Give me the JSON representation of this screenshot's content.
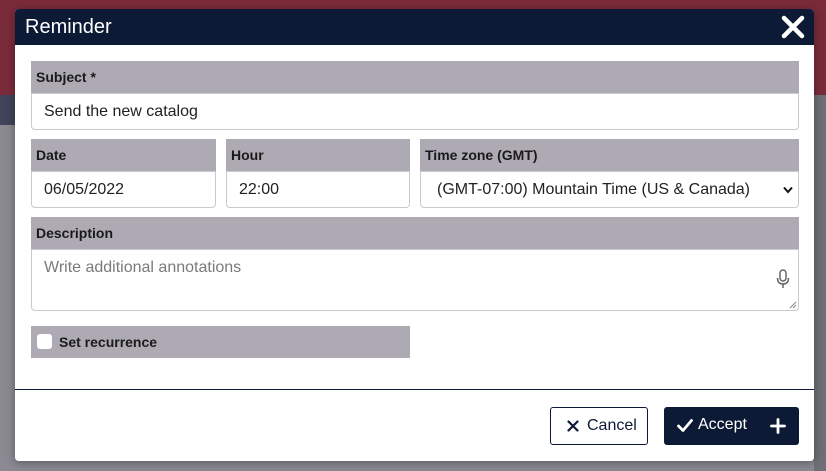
{
  "modal": {
    "title": "Reminder",
    "close_icon": "close-icon"
  },
  "form": {
    "subject": {
      "label": "Subject *",
      "value": "Send the new catalog"
    },
    "date": {
      "label": "Date",
      "value": "06/05/2022"
    },
    "hour": {
      "label": "Hour",
      "value": "22:00"
    },
    "timezone": {
      "label": "Time zone (GMT)",
      "selected": "(GMT-07:00) Mountain Time (US & Canada)"
    },
    "description": {
      "label": "Description",
      "placeholder": "Write additional annotations",
      "mic_icon": "microphone-icon"
    },
    "recurrence": {
      "label": "Set recurrence",
      "checked": false
    }
  },
  "footer": {
    "cancel_label": "Cancel",
    "cancel_icon": "times-icon",
    "accept_label": "Accept",
    "accept_icon": "check-icon",
    "accept_extra_icon": "plus-icon"
  },
  "colors": {
    "header_bg": "#0c1a35",
    "label_bg": "#aeaab4",
    "accent": "#0c1a35"
  }
}
